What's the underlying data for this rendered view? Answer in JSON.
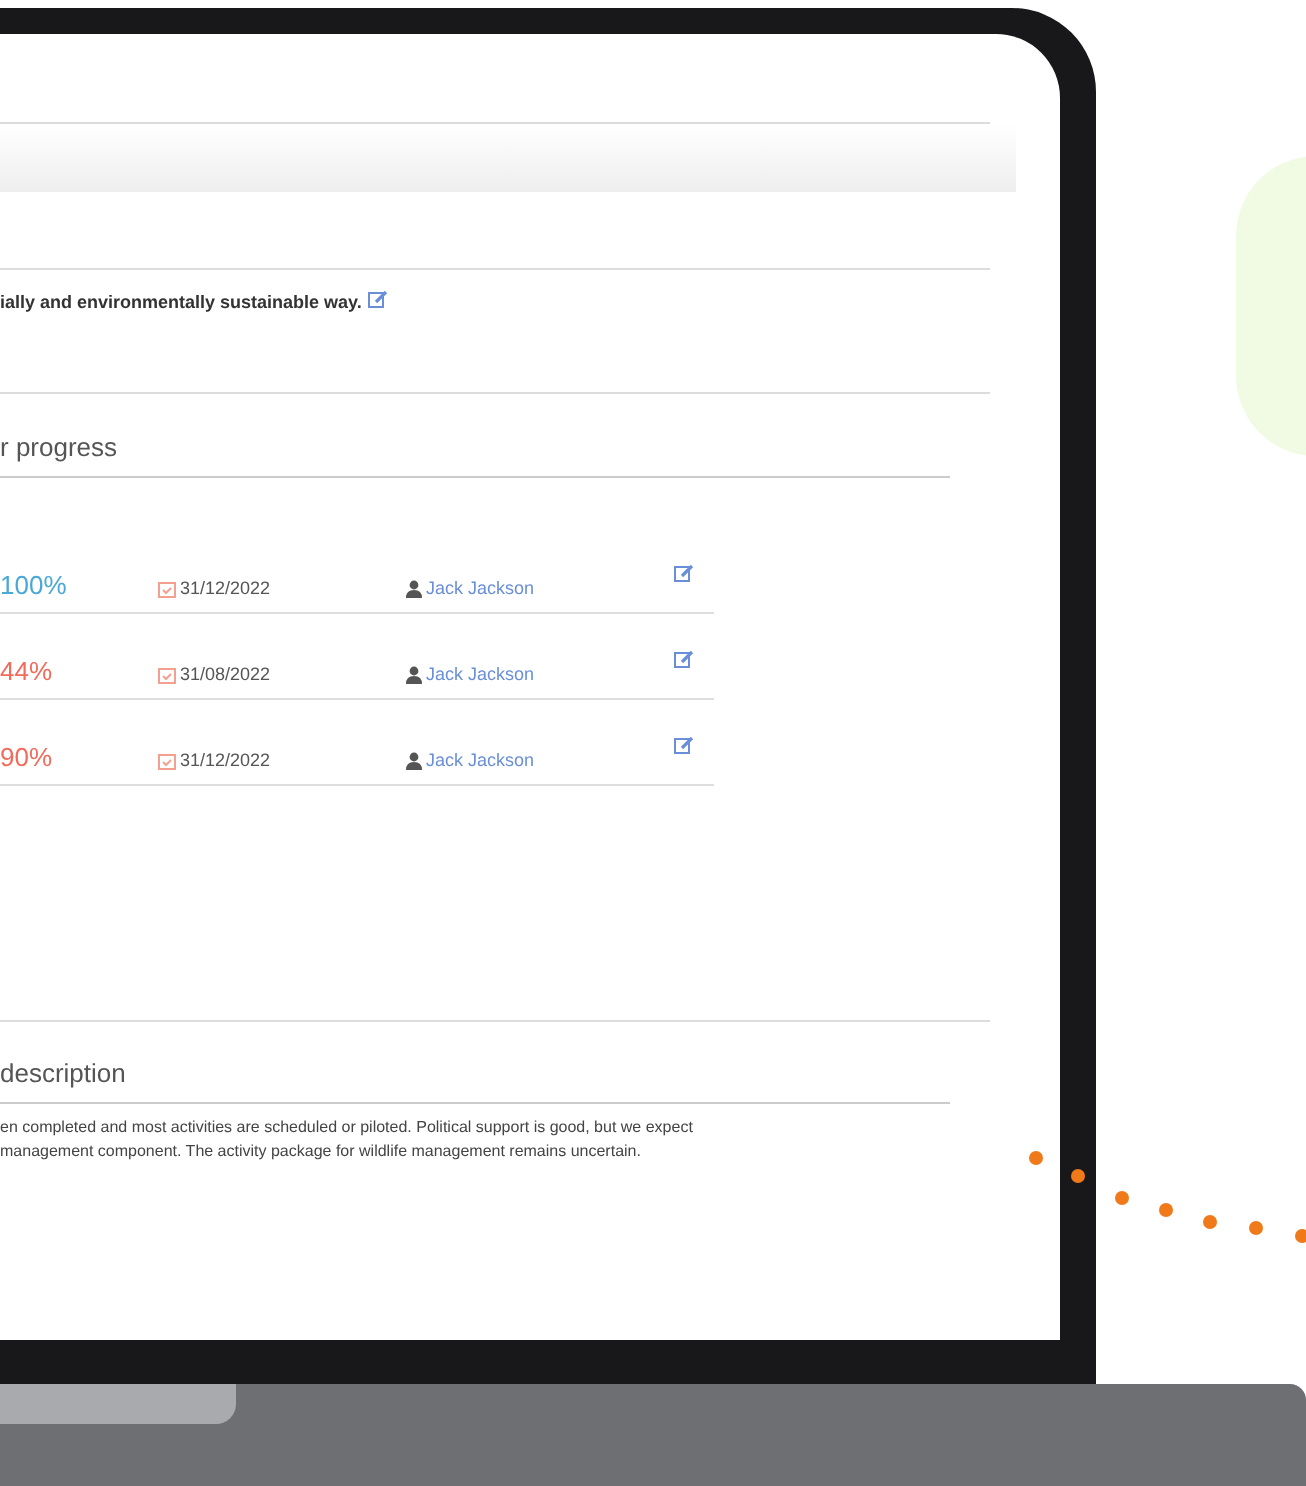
{
  "goal": {
    "text": "ially and environmentally sustainable way."
  },
  "progress": {
    "title": "r progress",
    "rows": [
      {
        "percent": "100%",
        "color": "#4aa8d8",
        "date": "31/12/2022",
        "owner": "Jack Jackson"
      },
      {
        "percent": "44%",
        "color": "#f26b5b",
        "date": "31/08/2022",
        "owner": "Jack Jackson"
      },
      {
        "percent": "90%",
        "color": "#f26b5b",
        "date": "31/12/2022",
        "owner": "Jack Jackson"
      }
    ]
  },
  "description": {
    "title": "description",
    "lines": [
      "en completed and most activities are scheduled or piloted. Political support is good, but we expect",
      "management component. The activity package for wildlife management remains uncertain."
    ]
  }
}
